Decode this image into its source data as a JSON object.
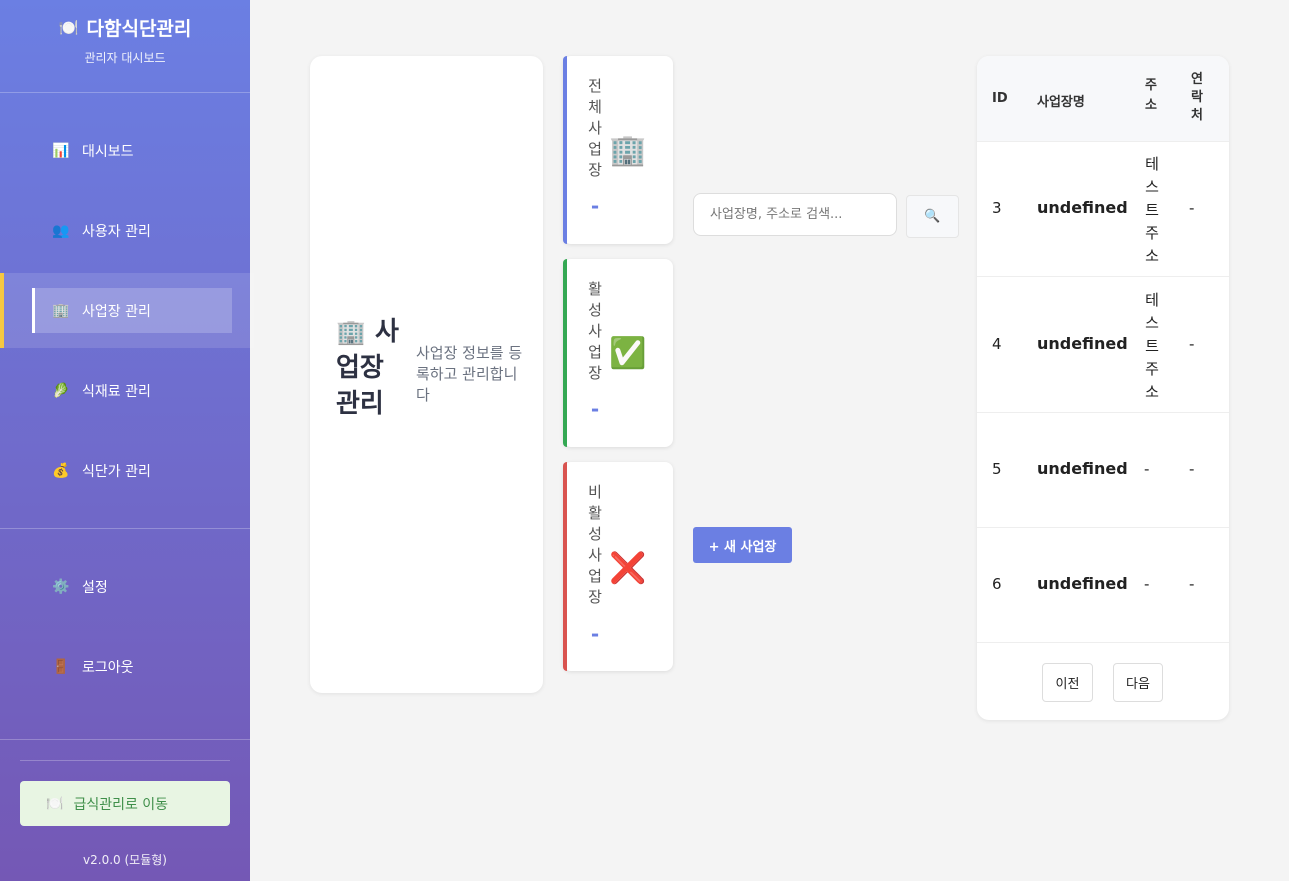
{
  "sidebar": {
    "brand_icon": "plate-icon",
    "brand_title": "다함식단관리",
    "brand_subtitle": "관리자 대시보드",
    "items": [
      {
        "icon": "📊",
        "icon_name": "chart-icon",
        "label": "대시보드"
      },
      {
        "icon": "👥",
        "icon_name": "users-icon",
        "label": "사용자 관리"
      },
      {
        "icon": "🏢",
        "icon_name": "building-icon",
        "label": "사업장 관리",
        "active": true
      },
      {
        "icon": "🥬",
        "icon_name": "leaf-icon",
        "label": "식재료 관리"
      },
      {
        "icon": "💰",
        "icon_name": "money-bag-icon",
        "label": "식단가 관리"
      },
      {
        "icon": "⚙️",
        "icon_name": "gear-icon",
        "label": "설정"
      },
      {
        "icon": "🚪",
        "icon_name": "door-icon",
        "label": "로그아웃"
      }
    ],
    "goto_button": {
      "icon": "🍽️",
      "label": "급식관리로 이동"
    },
    "version": "v2.0.0 (모듈형)"
  },
  "header": {
    "icon": "🏢",
    "title": "사업장 관리",
    "description": "사업장 정보를 등록하고 관리합니다"
  },
  "stats": [
    {
      "label": "전체사업장",
      "icon": "🏢",
      "icon_name": "building-icon",
      "value": "-",
      "color": "#6b7fe3"
    },
    {
      "label": "활성사업장",
      "icon": "✅",
      "icon_name": "check-icon",
      "value": "-",
      "color": "#34a853"
    },
    {
      "label": "비활성사업장",
      "icon": "❌",
      "icon_name": "cross-icon",
      "value": "-",
      "color": "#d9534f"
    }
  ],
  "search": {
    "placeholder": "사업장명, 주소로 검색...",
    "button_icon": "🔍"
  },
  "new_button": "+ 새 사업장",
  "table": {
    "headers": {
      "id": "ID",
      "name": "사업장명",
      "address": "주소",
      "contact": "연락처"
    },
    "rows": [
      {
        "id": "3",
        "name": "undefined",
        "address": "테스트주소",
        "contact": "-"
      },
      {
        "id": "4",
        "name": "undefined",
        "address": "테스트주소",
        "contact": "-"
      },
      {
        "id": "5",
        "name": "undefined",
        "address": "-",
        "contact": "-"
      },
      {
        "id": "6",
        "name": "undefined",
        "address": "-",
        "contact": "-"
      }
    ]
  },
  "pagination": {
    "prev": "이전",
    "next": "다음"
  }
}
